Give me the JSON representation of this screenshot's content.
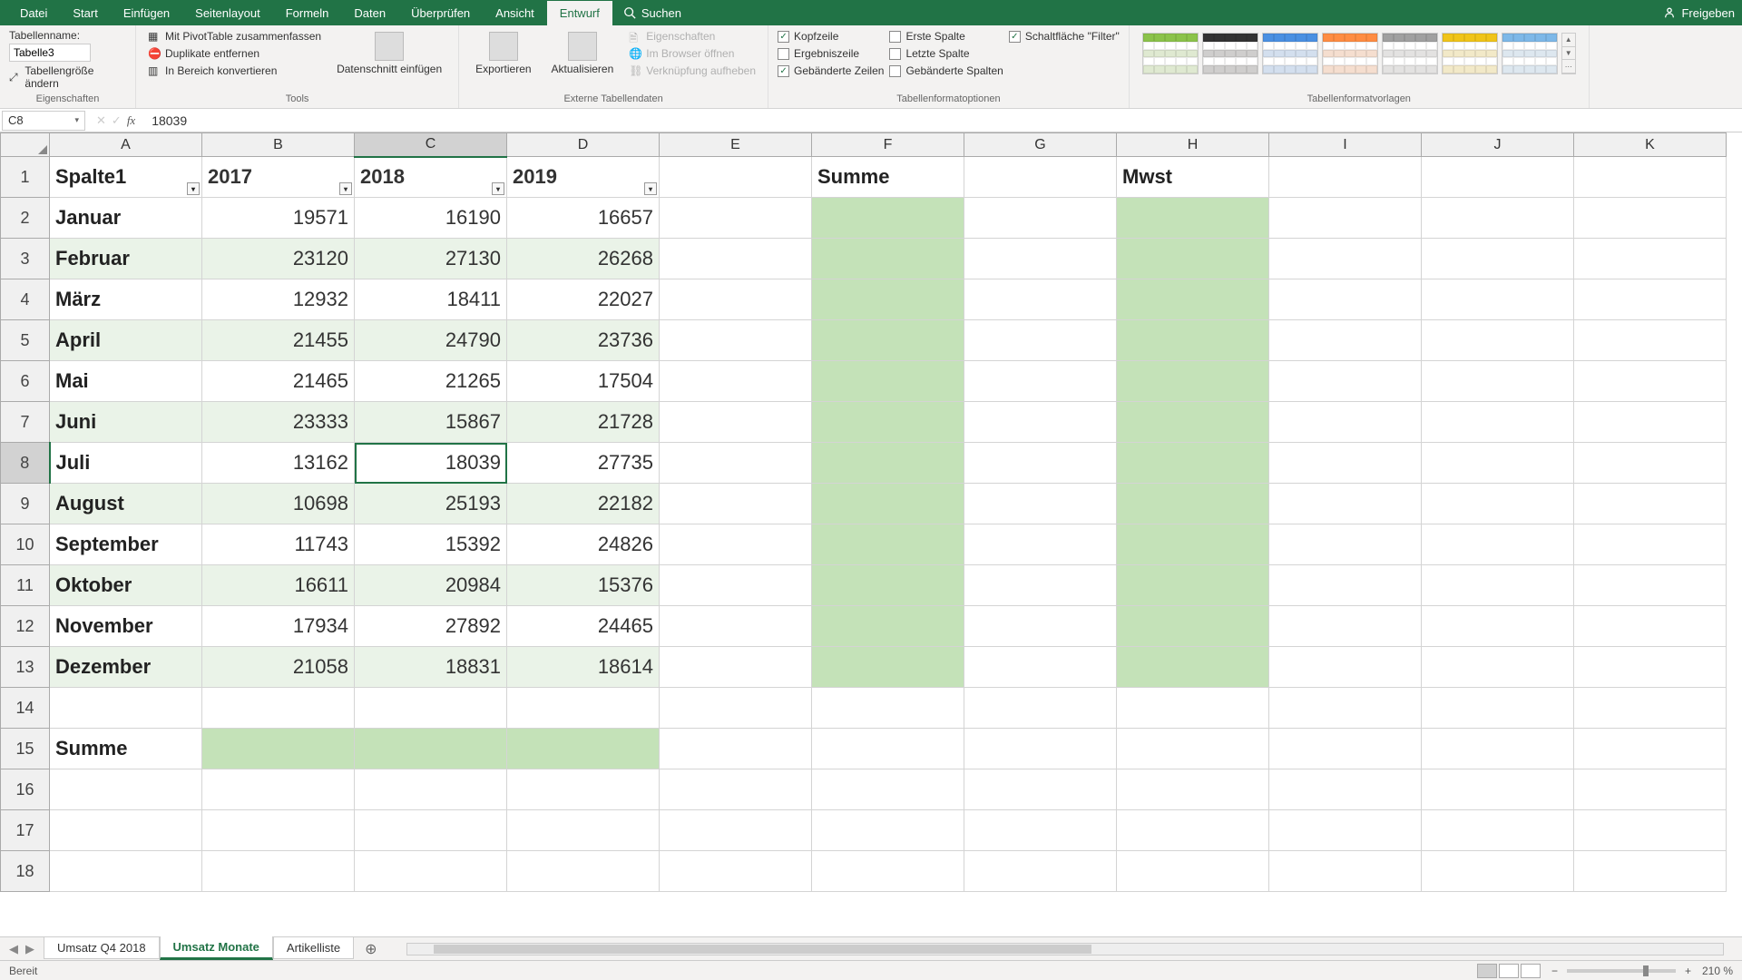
{
  "menu": {
    "items": [
      "Datei",
      "Start",
      "Einfügen",
      "Seitenlayout",
      "Formeln",
      "Daten",
      "Überprüfen",
      "Ansicht",
      "Entwurf"
    ],
    "active": "Entwurf",
    "search": "Suchen",
    "share": "Freigeben"
  },
  "ribbon": {
    "props": {
      "table_name_label": "Tabellenname:",
      "table_name_value": "Tabelle3",
      "resize": "Tabellengröße ändern",
      "group": "Eigenschaften"
    },
    "tools": {
      "pivot": "Mit PivotTable zusammenfassen",
      "dedupe": "Duplikate entfernen",
      "convert": "In Bereich konvertieren",
      "slicer": "Datenschnitt einfügen",
      "group": "Tools"
    },
    "external": {
      "export": "Exportieren",
      "refresh": "Aktualisieren",
      "props": "Eigenschaften",
      "browser": "Im Browser öffnen",
      "unlink": "Verknüpfung aufheben",
      "group": "Externe Tabellendaten"
    },
    "options": {
      "header_row": "Kopfzeile",
      "total_row": "Ergebniszeile",
      "banded_rows": "Gebänderte Zeilen",
      "first_col": "Erste Spalte",
      "last_col": "Letzte Spalte",
      "banded_cols": "Gebänderte Spalten",
      "filter_btn": "Schaltfläche \"Filter\"",
      "group": "Tabellenformatoptionen"
    },
    "styles": {
      "group": "Tabellenformatvorlagen"
    }
  },
  "formula": {
    "name_box": "C8",
    "value": "18039"
  },
  "cols": [
    "A",
    "B",
    "C",
    "D",
    "E",
    "F",
    "G",
    "H",
    "I",
    "J",
    "K"
  ],
  "col_widths": [
    "colA",
    "colB",
    "colC",
    "colD",
    "colE",
    "colF",
    "colG",
    "colH",
    "colI",
    "colJ",
    "colK"
  ],
  "selected_col": "C",
  "selected_row": 8,
  "chart_data": {
    "type": "table",
    "headers": {
      "A": "Spalte1",
      "B": "2017",
      "C": "2018",
      "D": "2019",
      "F": "Summe",
      "H": "Mwst"
    },
    "rows": [
      {
        "label": "Januar",
        "b": 19571,
        "c": 16190,
        "d": 16657
      },
      {
        "label": "Februar",
        "b": 23120,
        "c": 27130,
        "d": 26268
      },
      {
        "label": "März",
        "b": 12932,
        "c": 18411,
        "d": 22027
      },
      {
        "label": "April",
        "b": 21455,
        "c": 24790,
        "d": 23736
      },
      {
        "label": "Mai",
        "b": 21465,
        "c": 21265,
        "d": 17504
      },
      {
        "label": "Juni",
        "b": 23333,
        "c": 15867,
        "d": 21728
      },
      {
        "label": "Juli",
        "b": 13162,
        "c": 18039,
        "d": 27735
      },
      {
        "label": "August",
        "b": 10698,
        "c": 25193,
        "d": 22182
      },
      {
        "label": "September",
        "b": 11743,
        "c": 15392,
        "d": 24826
      },
      {
        "label": "Oktober",
        "b": 16611,
        "c": 20984,
        "d": 15376
      },
      {
        "label": "November",
        "b": 17934,
        "c": 27892,
        "d": 24465
      },
      {
        "label": "Dezember",
        "b": 21058,
        "c": 18831,
        "d": 18614
      }
    ],
    "summary_label": "Summe"
  },
  "tabs": {
    "items": [
      "Umsatz Q4 2018",
      "Umsatz Monate",
      "Artikelliste"
    ],
    "active": "Umsatz Monate"
  },
  "status": {
    "ready": "Bereit",
    "zoom": "210 %"
  },
  "style_colors": [
    "#8bc34a",
    "#333333",
    "#4a90e2",
    "#ff8c42",
    "#a0a0a0",
    "#f0c419",
    "#7db8e8"
  ]
}
